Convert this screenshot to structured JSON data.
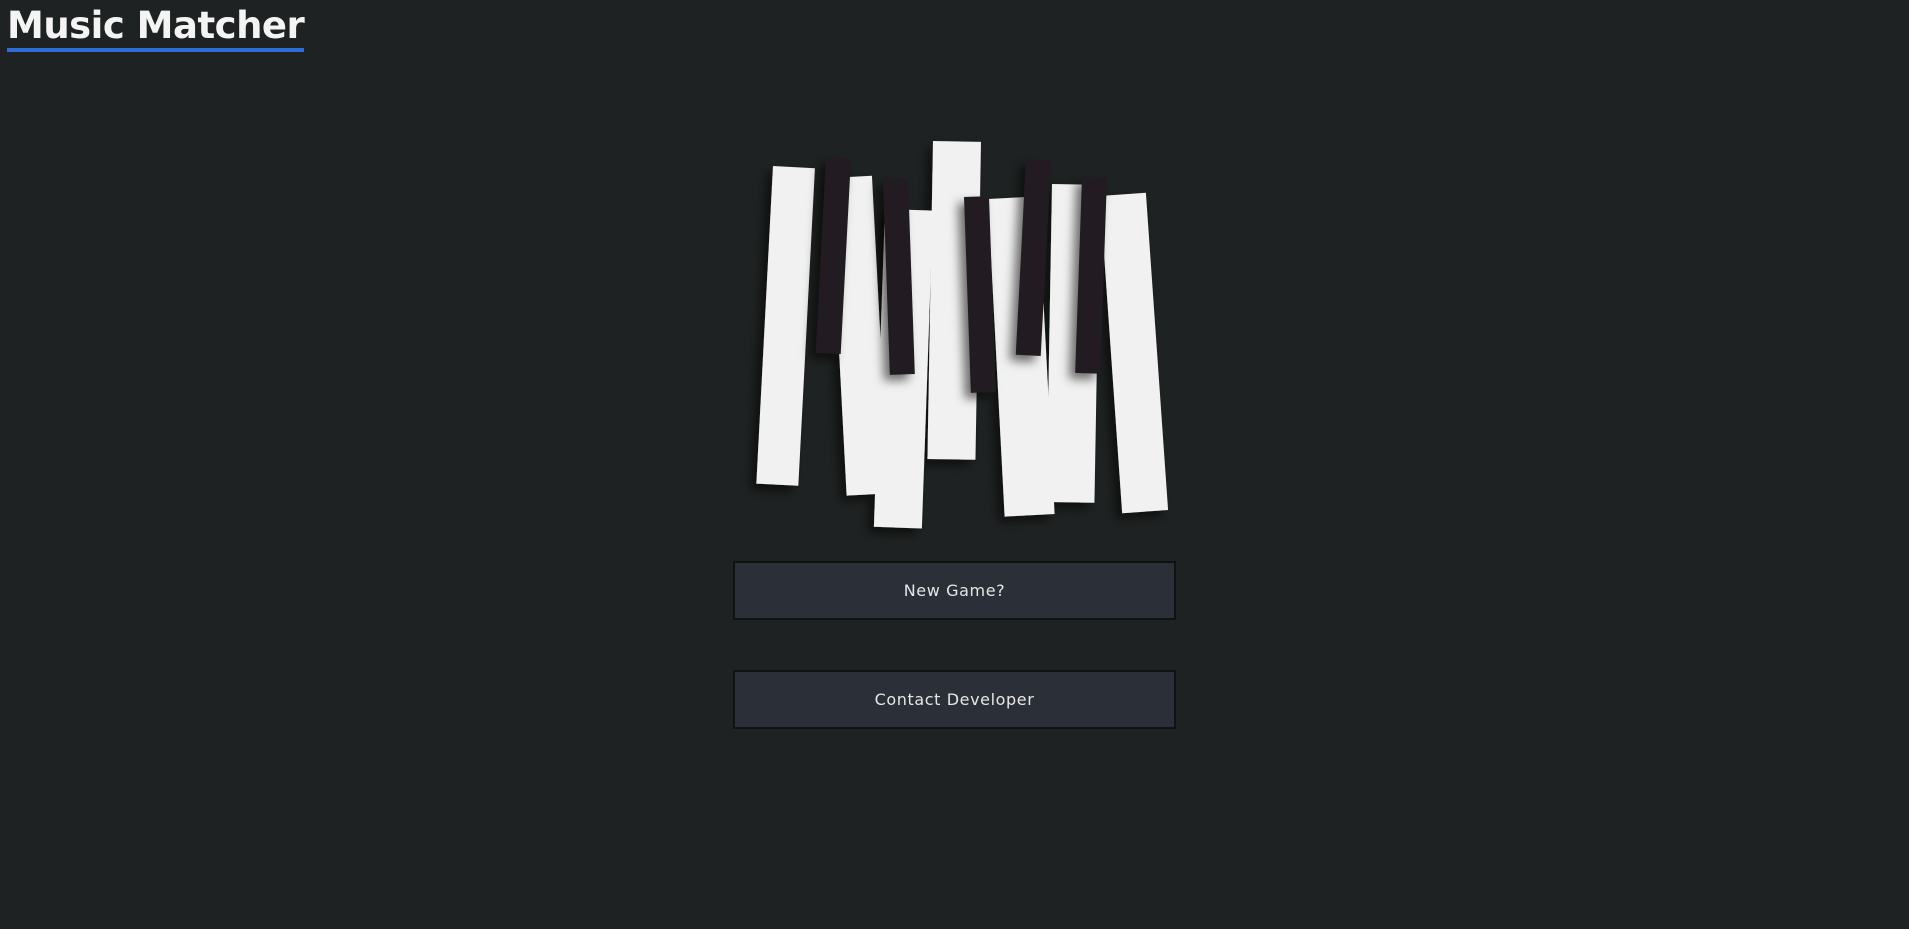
{
  "header": {
    "title": "Music Matcher",
    "underline_color": "#2d6fd6"
  },
  "hero": {
    "image_icon": "piano-keys-icon"
  },
  "menu": {
    "new_game_label": "New Game?",
    "contact_label": "Contact Developer"
  },
  "colors": {
    "background": "#1f2222",
    "button_bg": "#2b2f37",
    "white_key": "#f1f1f1",
    "black_key": "#211f20"
  }
}
